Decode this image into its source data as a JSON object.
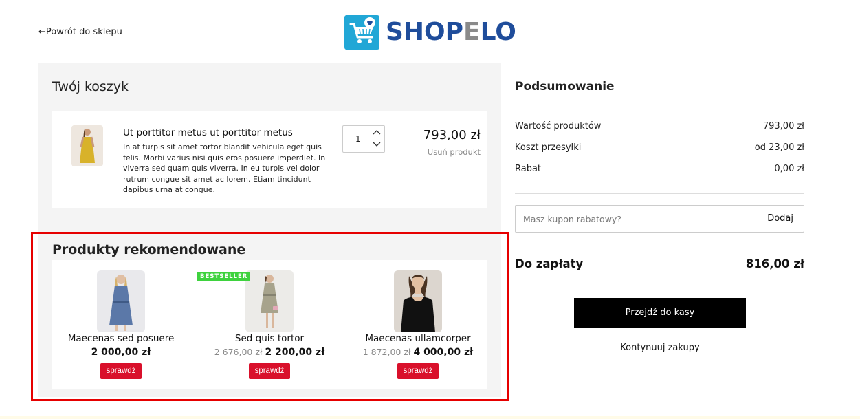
{
  "header": {
    "back_link": "←Powrót do sklepu",
    "logo": {
      "part1": "SHOP",
      "part2": "E",
      "part3": "LO",
      "icon": "shopping-cart-heart-icon"
    }
  },
  "cart": {
    "title": "Twój koszyk",
    "item": {
      "name": "Ut porttitor metus ut porttitor metus",
      "description": "In at turpis sit amet tortor blandit vehicula eget quis felis. Morbi varius nisi quis eros posuere imperdiet. In viverra sed quam quis viverra. In eu turpis vel dolor rutrum congue sit amet ac lorem. Etiam tincidunt dapibus urna at congue.",
      "quantity": "1",
      "price": "793,00 zł",
      "remove_label": "Usuń produkt"
    }
  },
  "recommended": {
    "title": "Produkty rekomendowane",
    "products": [
      {
        "name": "Maecenas sed posuere",
        "old_price": "",
        "price": "2 000,00 zł",
        "button": "sprawdź",
        "badge": ""
      },
      {
        "name": "Sed quis tortor",
        "old_price": "2 676,00 zł",
        "price": "2 200,00 zł",
        "button": "sprawdź",
        "badge": "BESTSELLER"
      },
      {
        "name": "Maecenas ullamcorper",
        "old_price": "1 872,00 zł",
        "price": "4 000,00 zł",
        "button": "sprawdź",
        "badge": ""
      }
    ]
  },
  "summary": {
    "title": "Podsumowanie",
    "rows": [
      {
        "label": "Wartość produktów",
        "value": "793,00 zł"
      },
      {
        "label": "Koszt przesyłki",
        "value": "od 23,00 zł"
      },
      {
        "label": "Rabat",
        "value": "0,00 zł"
      }
    ],
    "coupon": {
      "placeholder": "Masz kupon rabatowy?",
      "button": "Dodaj"
    },
    "total": {
      "label": "Do zapłaty",
      "value": "816,00 zł"
    },
    "checkout_button": "Przejdź do kasy",
    "continue_link": "Kontynuuj zakupy"
  },
  "colors": {
    "accent_red": "#d9102b",
    "badge_green": "#3ed23e",
    "logo_blue": "#1f4d9b",
    "logo_icon_bg": "#21a7d6",
    "highlight_frame": "#e60000"
  }
}
